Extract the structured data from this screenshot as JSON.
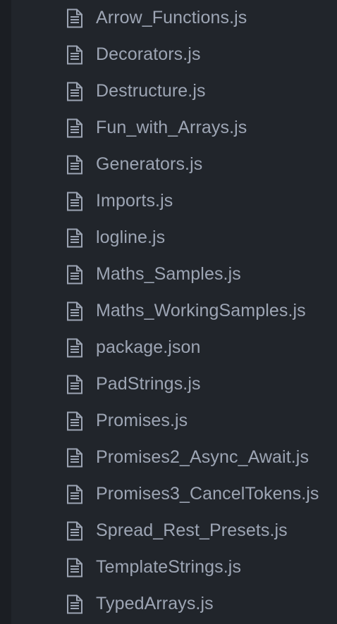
{
  "tree_view": {
    "files": [
      {
        "name": "Arrow_Functions.js",
        "icon": "file-text-icon"
      },
      {
        "name": "Decorators.js",
        "icon": "file-text-icon"
      },
      {
        "name": "Destructure.js",
        "icon": "file-text-icon"
      },
      {
        "name": "Fun_with_Arrays.js",
        "icon": "file-text-icon"
      },
      {
        "name": "Generators.js",
        "icon": "file-text-icon"
      },
      {
        "name": "Imports.js",
        "icon": "file-text-icon"
      },
      {
        "name": "logline.js",
        "icon": "file-text-icon"
      },
      {
        "name": "Maths_Samples.js",
        "icon": "file-text-icon"
      },
      {
        "name": "Maths_WorkingSamples.js",
        "icon": "file-text-icon"
      },
      {
        "name": "package.json",
        "icon": "file-text-icon"
      },
      {
        "name": "PadStrings.js",
        "icon": "file-text-icon"
      },
      {
        "name": "Promises.js",
        "icon": "file-text-icon"
      },
      {
        "name": "Promises2_Async_Await.js",
        "icon": "file-text-icon"
      },
      {
        "name": "Promises3_CancelTokens.js",
        "icon": "file-text-icon"
      },
      {
        "name": "Spread_Rest_Presets.js",
        "icon": "file-text-icon"
      },
      {
        "name": "TemplateStrings.js",
        "icon": "file-text-icon"
      },
      {
        "name": "TypedArrays.js",
        "icon": "file-text-icon"
      }
    ]
  },
  "colors": {
    "background": "#21252b",
    "gutter": "#1b1e23",
    "text": "#9da5b4",
    "icon": "#9da5b4"
  }
}
